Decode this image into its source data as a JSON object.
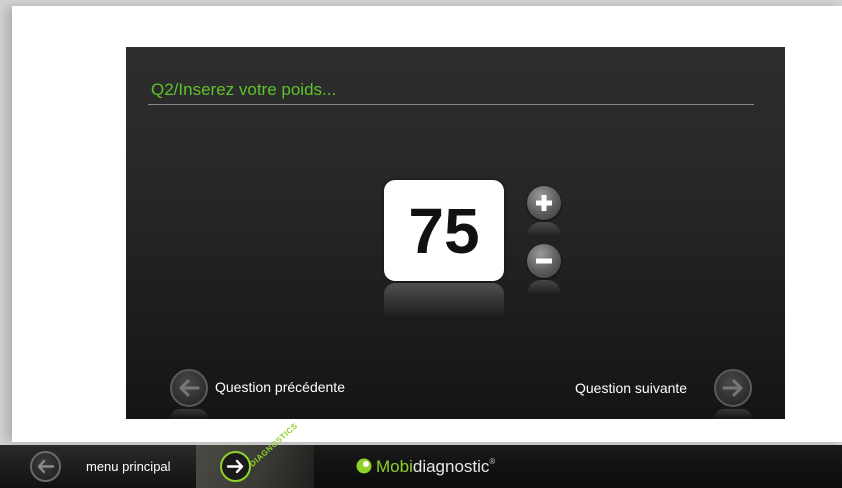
{
  "question": {
    "title": "Q2/Inserez votre poids..."
  },
  "weight": {
    "value": "75"
  },
  "controls": {
    "increment_icon": "plus-icon",
    "decrement_icon": "minus-icon"
  },
  "navigation": {
    "previous_label": "Question précédente",
    "next_label": "Question suivante",
    "previous_icon": "arrow-left-icon",
    "next_icon": "arrow-right-icon"
  },
  "footer": {
    "menu_label": "menu principal",
    "diagnostics_label": "DIAGNOSTICS",
    "logo_part1": "Mobi",
    "logo_part2": "diagnostic",
    "logo_reg": "®"
  },
  "colors": {
    "accent_green": "#8fd12a",
    "title_green": "#5ec22a",
    "panel_dark": "#262626"
  }
}
